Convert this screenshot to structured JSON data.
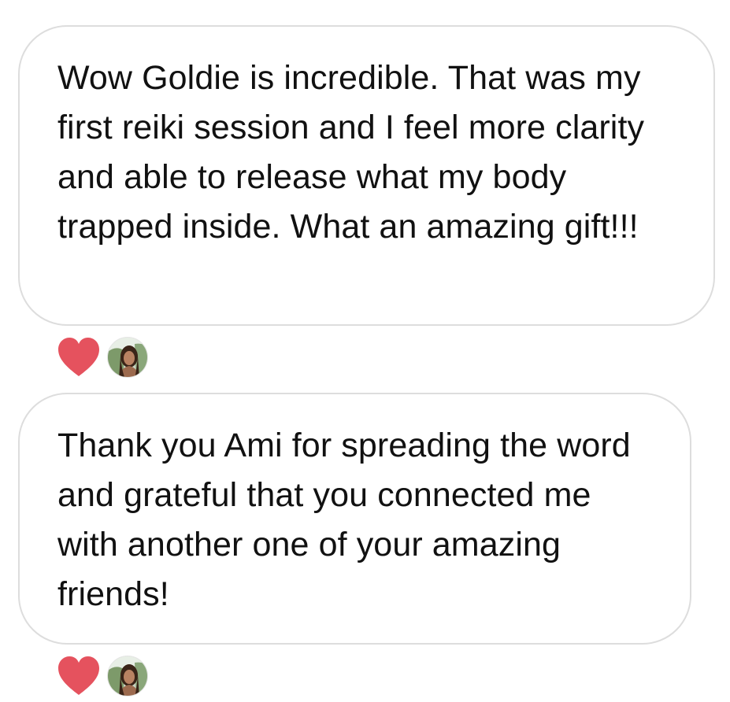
{
  "comments": [
    {
      "text": "Wow Goldie is incredible. That was my first reiki session and I feel more clarity and able to release what my body trapped inside. What an amazing gift!!!",
      "reaction_icon": "heart-icon",
      "reaction_color": "#E5525E"
    },
    {
      "text": "Thank you Ami for spreading the word and grateful that you connected me with another one of your amazing friends!",
      "reaction_icon": "heart-icon",
      "reaction_color": "#E5525E"
    }
  ],
  "colors": {
    "bubble_border": "#DDDDDD",
    "text": "#111111",
    "background": "#FFFFFF"
  }
}
